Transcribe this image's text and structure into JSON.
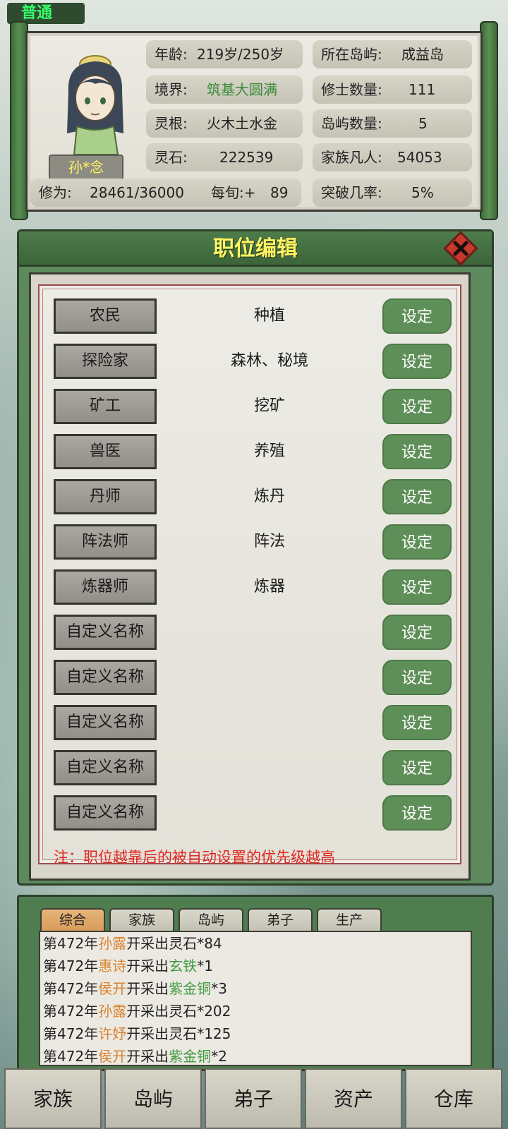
{
  "top_tag": "普通",
  "player": {
    "name": "孙*念",
    "age_label": "年龄:",
    "age_value": "219岁/250岁",
    "realm_label": "境界:",
    "realm_value": "筑基大圆满",
    "root_label": "灵根:",
    "root_value": "火木土水金",
    "stone_label": "灵石:",
    "stone_value": "222539",
    "cult_label": "修为:",
    "cult_value": "28461/36000",
    "per_turn_label": "每旬:+",
    "per_turn_value": "89",
    "island_label": "所在岛屿:",
    "island_value": "成益岛",
    "cultivators_label": "修士数量:",
    "cultivators_value": "111",
    "islands_label": "岛屿数量:",
    "islands_value": "5",
    "mortals_label": "家族凡人:",
    "mortals_value": "54053",
    "breakthrough_label": "突破几率:",
    "breakthrough_value": "5%"
  },
  "job_editor": {
    "title": "职位编辑",
    "close_icon": "close-x-icon",
    "set_label": "设定",
    "rows": [
      {
        "role": "农民",
        "desc": "种植"
      },
      {
        "role": "探险家",
        "desc": "森林、秘境"
      },
      {
        "role": "矿工",
        "desc": "挖矿"
      },
      {
        "role": "兽医",
        "desc": "养殖"
      },
      {
        "role": "丹师",
        "desc": "炼丹"
      },
      {
        "role": "阵法师",
        "desc": "阵法"
      },
      {
        "role": "炼器师",
        "desc": "炼器"
      },
      {
        "role": "自定义名称",
        "desc": ""
      },
      {
        "role": "自定义名称",
        "desc": ""
      },
      {
        "role": "自定义名称",
        "desc": ""
      },
      {
        "role": "自定义名称",
        "desc": ""
      },
      {
        "role": "自定义名称",
        "desc": ""
      }
    ],
    "note": "注：职位越靠后的被自动设置的优先级越高"
  },
  "log": {
    "tabs": [
      "综合",
      "家族",
      "岛屿",
      "弟子",
      "生产"
    ],
    "active_tab": "综合",
    "entries": [
      {
        "year": "第472年",
        "who": "孙露",
        "action": "开采出",
        "item": "灵石",
        "qty": "*84",
        "item_color": "plain"
      },
      {
        "year": "第472年",
        "who": "惠诗",
        "action": "开采出",
        "item": "玄铁",
        "qty": "*1",
        "item_color": "green"
      },
      {
        "year": "第472年",
        "who": "侯开",
        "action": "开采出",
        "item": "紫金铜",
        "qty": "*3",
        "item_color": "green"
      },
      {
        "year": "第472年",
        "who": "孙露",
        "action": "开采出",
        "item": "灵石",
        "qty": "*202",
        "item_color": "plain"
      },
      {
        "year": "第472年",
        "who": "许妤",
        "action": "开采出",
        "item": "灵石",
        "qty": "*125",
        "item_color": "plain"
      },
      {
        "year": "第472年",
        "who": "侯开",
        "action": "开采出",
        "item": "紫金铜",
        "qty": "*2",
        "item_color": "green"
      }
    ]
  },
  "bottom_nav": [
    "家族",
    "岛屿",
    "弟子",
    "资产",
    "仓库"
  ],
  "colors": {
    "accent_yellow": "#fff463",
    "realm_green": "#3b8a3b",
    "note_red": "#e0261e",
    "name_orange": "#d9822e",
    "item_green": "#3f9a3f",
    "set_button": "#5f8f58"
  }
}
